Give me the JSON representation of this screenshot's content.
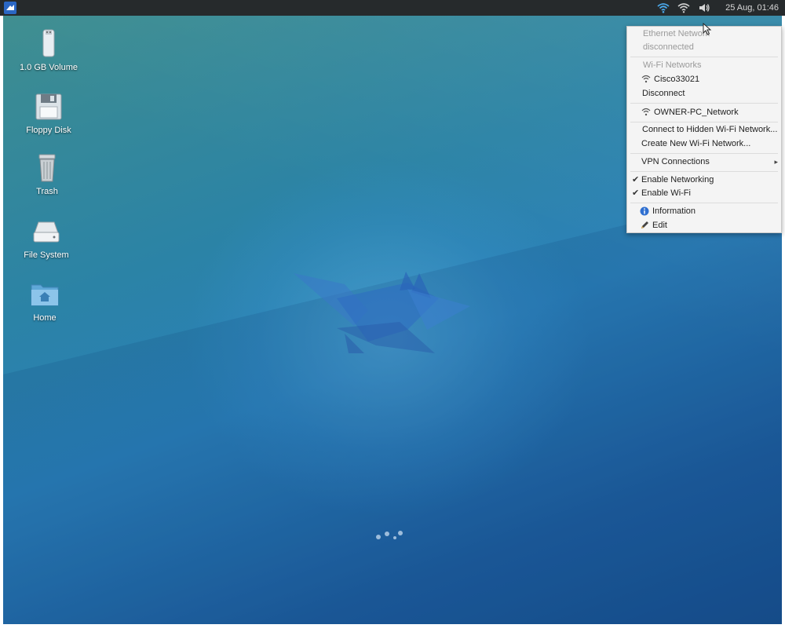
{
  "panel": {
    "clock": "25 Aug, 01:46"
  },
  "desktop_icons": [
    {
      "label": "1.0 GB Volume"
    },
    {
      "label": "Floppy Disk"
    },
    {
      "label": "Trash"
    },
    {
      "label": "File System"
    },
    {
      "label": "Home"
    }
  ],
  "network_menu": {
    "ethernet_header": "Ethernet Network",
    "ethernet_status": "disconnected",
    "wifi_header": "Wi-Fi Networks",
    "active_network": "Cisco33021",
    "disconnect": "Disconnect",
    "other_network": "OWNER-PC_Network",
    "connect_hidden": "Connect to Hidden Wi-Fi Network...",
    "create_new": "Create New Wi-Fi Network...",
    "vpn": "VPN Connections",
    "enable_networking": "Enable Networking",
    "enable_wifi": "Enable Wi-Fi",
    "information": "Information",
    "edit": "Edit"
  },
  "colors": {
    "panel_bg": "#262a2c",
    "desktop_top": "#3f8e8e",
    "desktop_bottom": "#17508e",
    "menu_bg": "#f4f4f4",
    "info_blue": "#2f6fd0"
  },
  "icons": [
    "whisker-menu-icon",
    "wifi-icon",
    "network-manager-icon",
    "volume-icon",
    "usb-drive-icon",
    "floppy-disk-icon",
    "trash-icon",
    "drive-icon",
    "home-folder-icon",
    "wifi-signal-icon",
    "info-icon",
    "edit-icon",
    "checkmark-icon",
    "submenu-arrow-icon",
    "cursor-icon"
  ]
}
